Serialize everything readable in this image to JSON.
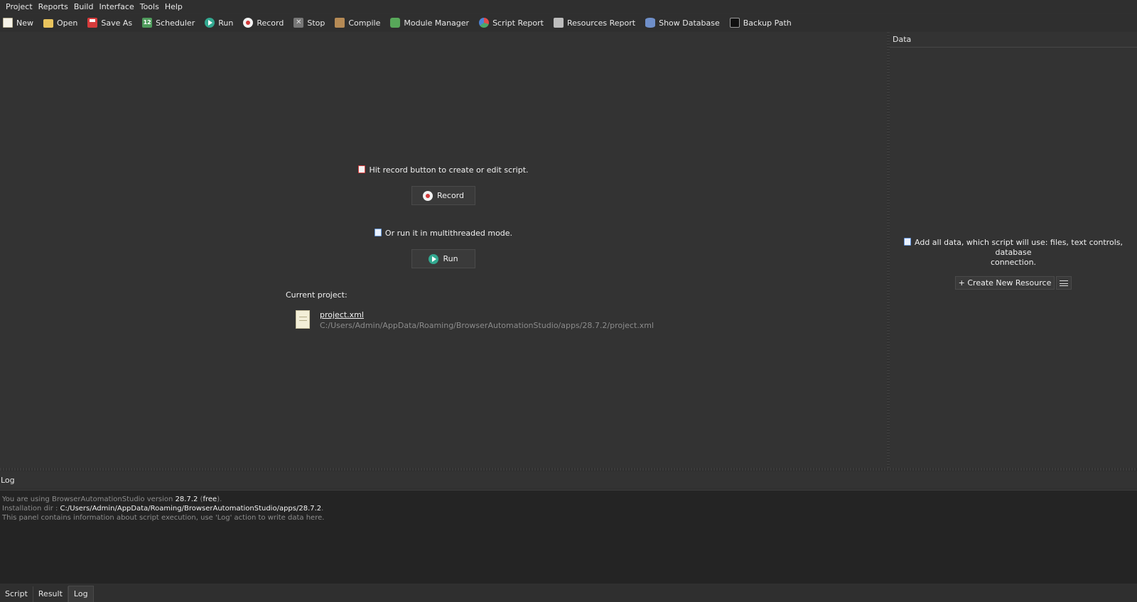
{
  "menubar": [
    "Project",
    "Reports",
    "Build",
    "Interface",
    "Tools",
    "Help"
  ],
  "toolbar": {
    "new": "New",
    "open": "Open",
    "save_as": "Save As",
    "scheduler": "Scheduler",
    "scheduler_day": "12",
    "run": "Run",
    "record": "Record",
    "stop": "Stop",
    "compile": "Compile",
    "module_manager": "Module Manager",
    "script_report": "Script Report",
    "resources_report": "Resources Report",
    "show_database": "Show Database",
    "backup_path": "Backup Path"
  },
  "main": {
    "record_hint": "Hit record button to create or edit script.",
    "record_button": "Record",
    "run_hint": "Or run it in multithreaded mode.",
    "run_button": "Run",
    "current_project_label": "Current project:",
    "project_file": "project.xml",
    "project_path": "C:/Users/Admin/AppData/Roaming/BrowserAutomationStudio/apps/28.7.2/project.xml"
  },
  "data_panel": {
    "title": "Data",
    "hint_line1": "Add all data, which script will use: files, text controls, database",
    "hint_line2": "connection.",
    "create_button": "+ Create New Resource"
  },
  "log": {
    "title": "Log",
    "line1_prefix": "You are using BrowserAutomationStudio version ",
    "line1_version": "28.7.2",
    "line1_mid": " (",
    "line1_edition": "free",
    "line1_suffix": ").",
    "line2_prefix": "Installation dir : ",
    "line2_path": "C:/Users/Admin/AppData/Roaming/BrowserAutomationStudio/apps/28.7.2",
    "line2_suffix": ".",
    "line3": "This panel contains information about script execution, use 'Log' action to write data here."
  },
  "bottom_tabs": [
    "Script",
    "Result",
    "Log"
  ],
  "active_tab": "Log"
}
